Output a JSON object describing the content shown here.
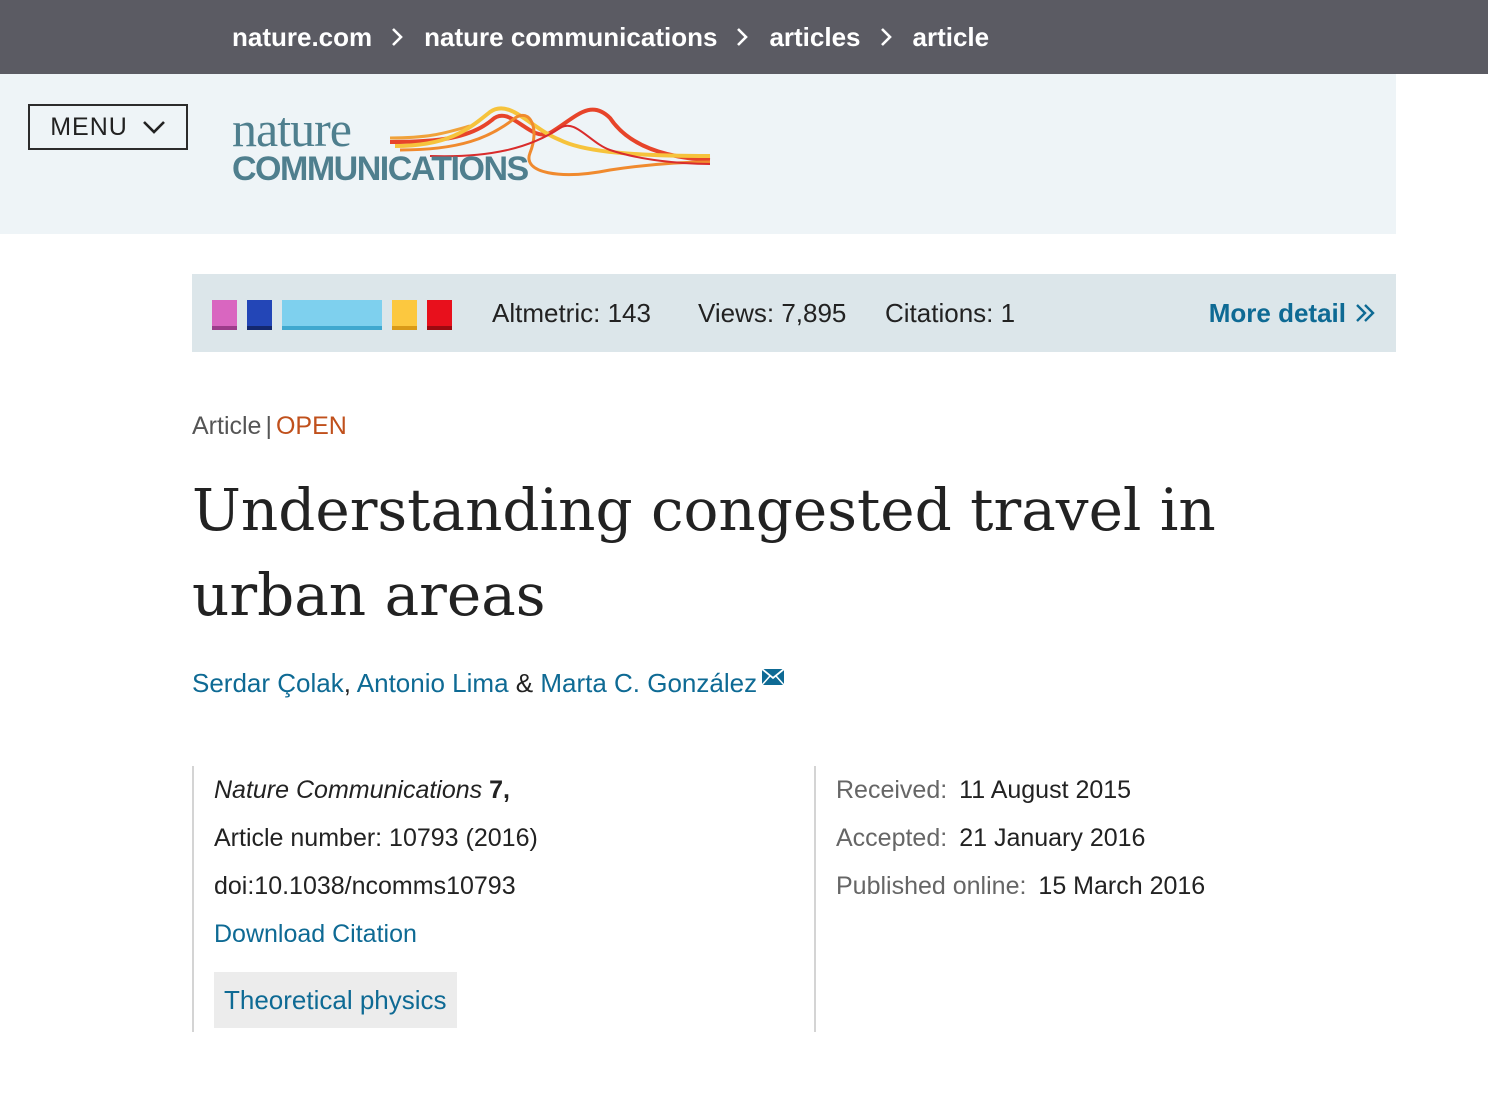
{
  "breadcrumb": {
    "items": [
      "nature.com",
      "nature communications",
      "articles",
      "article"
    ]
  },
  "header": {
    "menu_label": "MENU",
    "logo": {
      "line1": "nature",
      "line2": "COMMUNICATIONS"
    }
  },
  "metrics": {
    "altmetric": "Altmetric: 143",
    "views": "Views: 7,895",
    "citations": "Citations: 1",
    "more_detail": "More detail",
    "donut_colors": [
      "#d966c0",
      "#2346b7",
      "#7ed0ee",
      "#fcc83f",
      "#e8101c"
    ]
  },
  "article": {
    "type": "Article",
    "separator": "|",
    "access": "OPEN",
    "title": "Understanding congested travel in urban areas",
    "authors": [
      {
        "name": "Serdar Çolak"
      },
      {
        "name": "Antonio Lima"
      },
      {
        "name": "Marta C. González"
      }
    ],
    "author_sep_1": ",",
    "author_sep_2": "&",
    "journal": "Nature Communications",
    "volume": "7",
    "volume_suffix": ",",
    "article_number": "Article number: 10793 (2016)",
    "doi": "doi:10.1038/ncomms10793",
    "download_citation": "Download Citation",
    "subject": "Theoretical physics",
    "dates": {
      "received_label": "Received:",
      "received": "11 August 2015",
      "accepted_label": "Accepted:",
      "accepted": "21 January 2016",
      "published_label": "Published online:",
      "published": "15 March 2016"
    }
  }
}
